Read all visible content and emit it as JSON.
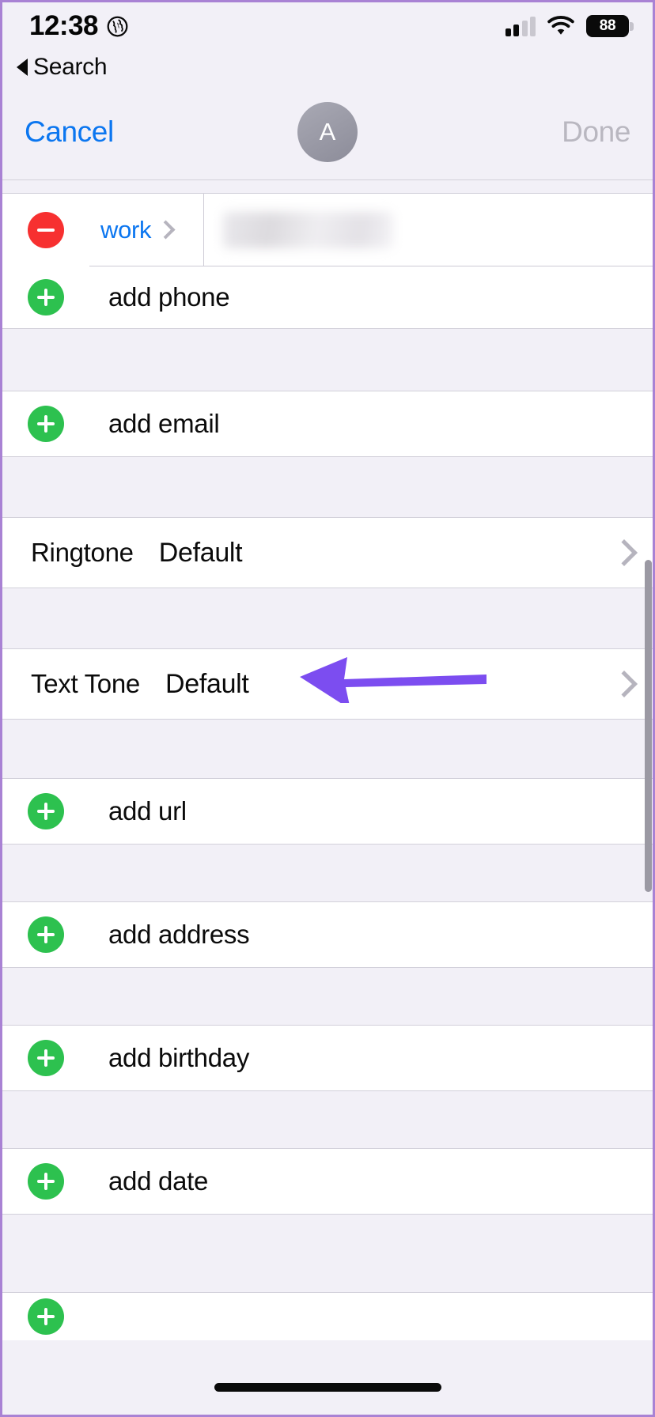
{
  "status_bar": {
    "time": "12:38",
    "location_icon": "globe-icon",
    "signal_icon": "cellular-signal-icon",
    "signal_bars_filled": 2,
    "signal_bars_total": 4,
    "wifi_icon": "wifi-icon",
    "battery_percent": "88",
    "battery_icon": "battery-icon"
  },
  "back_bar": {
    "icon": "back-triangle-icon",
    "label": "Search"
  },
  "nav_bar": {
    "cancel_label": "Cancel",
    "done_label": "Done",
    "avatar_initial": "A",
    "done_enabled": false
  },
  "colors": {
    "accent_blue": "#0b76f0",
    "disabled_gray": "#b9b7c0",
    "add_green": "#2dc14f",
    "delete_red": "#f73030",
    "annotation_purple": "#7c4df0",
    "page_background": "#f2f0f7",
    "card_background": "#ffffff",
    "frame_border": "#a982d4"
  },
  "sections": [
    {
      "type": "phone_group",
      "phone_entry": {
        "delete_icon": "minus-circle-icon",
        "label": "work",
        "label_chevron_icon": "chevron-right-icon",
        "value": "",
        "value_redacted": true
      },
      "add_row": {
        "icon": "plus-circle-icon",
        "label": "add phone"
      }
    },
    {
      "type": "add_row",
      "icon": "plus-circle-icon",
      "label": "add email"
    },
    {
      "type": "tone_row",
      "key": "Ringtone",
      "value": "Default",
      "chevron_icon": "chevron-right-icon",
      "annotated": false
    },
    {
      "type": "tone_row",
      "key": "Text Tone",
      "value": "Default",
      "chevron_icon": "chevron-right-icon",
      "annotated": true,
      "annotation_icon": "arrow-left-annotation"
    },
    {
      "type": "add_row",
      "icon": "plus-circle-icon",
      "label": "add url"
    },
    {
      "type": "add_row",
      "icon": "plus-circle-icon",
      "label": "add address"
    },
    {
      "type": "add_row",
      "icon": "plus-circle-icon",
      "label": "add birthday"
    },
    {
      "type": "add_row",
      "icon": "plus-circle-icon",
      "label": "add date"
    }
  ],
  "scrollbar": {
    "visible": true
  },
  "home_indicator": {
    "visible": true
  }
}
